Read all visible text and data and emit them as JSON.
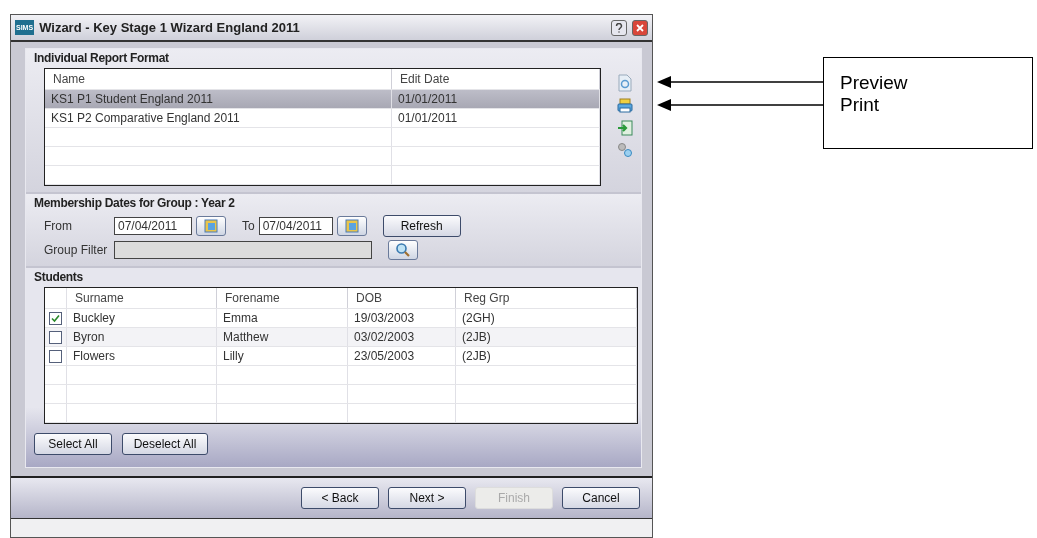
{
  "window": {
    "title": "Wizard - Key Stage 1 Wizard England 2011",
    "logo": "SIMS"
  },
  "report_format": {
    "title": "Individual Report Format",
    "columns": [
      "Name",
      "Edit Date"
    ],
    "rows": [
      {
        "name": "KS1 P1 Student England 2011",
        "edit_date": "01/01/2011",
        "selected": true
      },
      {
        "name": "KS1 P2 Comparative England 2011",
        "edit_date": "01/01/2011",
        "selected": false
      }
    ]
  },
  "membership": {
    "title": "Membership Dates for Group : Year 2",
    "from_label": "From",
    "from_value": "07/04/2011",
    "to_label": "To",
    "to_value": "07/04/2011",
    "refresh": "Refresh",
    "group_filter_label": "Group Filter",
    "group_filter_disabled": true
  },
  "students": {
    "title": "Students",
    "columns": [
      "Surname",
      "Forename",
      "DOB",
      "Reg Grp"
    ],
    "rows": [
      {
        "checked": true,
        "surname": "Buckley",
        "forename": "Emma",
        "dob": "19/03/2003",
        "reg_grp": "(2GH)"
      },
      {
        "checked": false,
        "surname": "Byron",
        "forename": "Matthew",
        "dob": "03/02/2003",
        "reg_grp": "(2JB)"
      },
      {
        "checked": false,
        "surname": "Flowers",
        "forename": "Lilly",
        "dob": "23/05/2003",
        "reg_grp": "(2JB)"
      }
    ],
    "buttons": [
      "Select All",
      "Deselect All"
    ]
  },
  "footer_buttons": [
    {
      "label": "< Back",
      "disabled": false
    },
    {
      "label": "Next >",
      "disabled": false
    },
    {
      "label": "Finish",
      "disabled": true
    },
    {
      "label": "Cancel",
      "disabled": false
    }
  ],
  "callout": {
    "lines": [
      "Preview",
      "Print"
    ]
  }
}
